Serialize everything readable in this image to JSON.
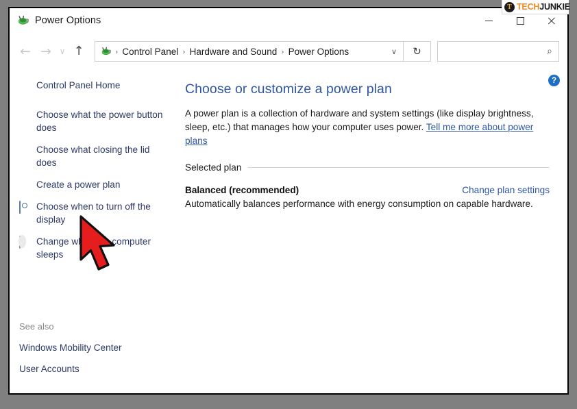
{
  "window": {
    "title": "Power Options",
    "app_icon": "power-plug-icon",
    "buttons": {
      "minimize": "minimize-icon",
      "maximize": "maximize-icon",
      "close": "close-icon"
    }
  },
  "watermark": {
    "badge": "T",
    "tech": "TECH",
    "junkie": "JUNKIE"
  },
  "nav": {
    "back": "←",
    "forward": "→",
    "recent": "∨",
    "up": "↑",
    "dropdown": "∨",
    "refresh": "↻",
    "breadcrumbs": [
      "Control Panel",
      "Hardware and Sound",
      "Power Options"
    ],
    "separator": "›"
  },
  "search": {
    "value": "",
    "placeholder": "",
    "icon": "⌕"
  },
  "help": {
    "label": "?"
  },
  "sidebar": {
    "home": "Control Panel Home",
    "items": [
      {
        "label": "Choose what the power button does",
        "icon": "none"
      },
      {
        "label": "Choose what closing the lid does",
        "icon": "none"
      },
      {
        "label": "Create a power plan",
        "icon": "none"
      },
      {
        "label": "Choose when to turn off the display",
        "icon": "display"
      },
      {
        "label": "Change when the computer sleeps",
        "icon": "sleep"
      }
    ],
    "see_also_title": "See also",
    "see_also": [
      "Windows Mobility Center",
      "User Accounts"
    ]
  },
  "main": {
    "heading": "Choose or customize a power plan",
    "description_part1": "A power plan is a collection of hardware and system settings (like display brightness, sleep, etc.) that manages how your computer uses power. ",
    "description_link": "Tell me more about power plans",
    "selected_plan_label": "Selected plan",
    "plan_name": "Balanced (recommended)",
    "change_plan_link": "Change plan settings",
    "plan_description": "Automatically balances performance with energy consumption on capable hardware."
  },
  "colors": {
    "accent_blue": "#2f55a4",
    "sidebar_link": "#2b3a66",
    "page_background": "#808080",
    "cursor_red": "#e51d1d",
    "brand_orange": "#ef8b22"
  }
}
